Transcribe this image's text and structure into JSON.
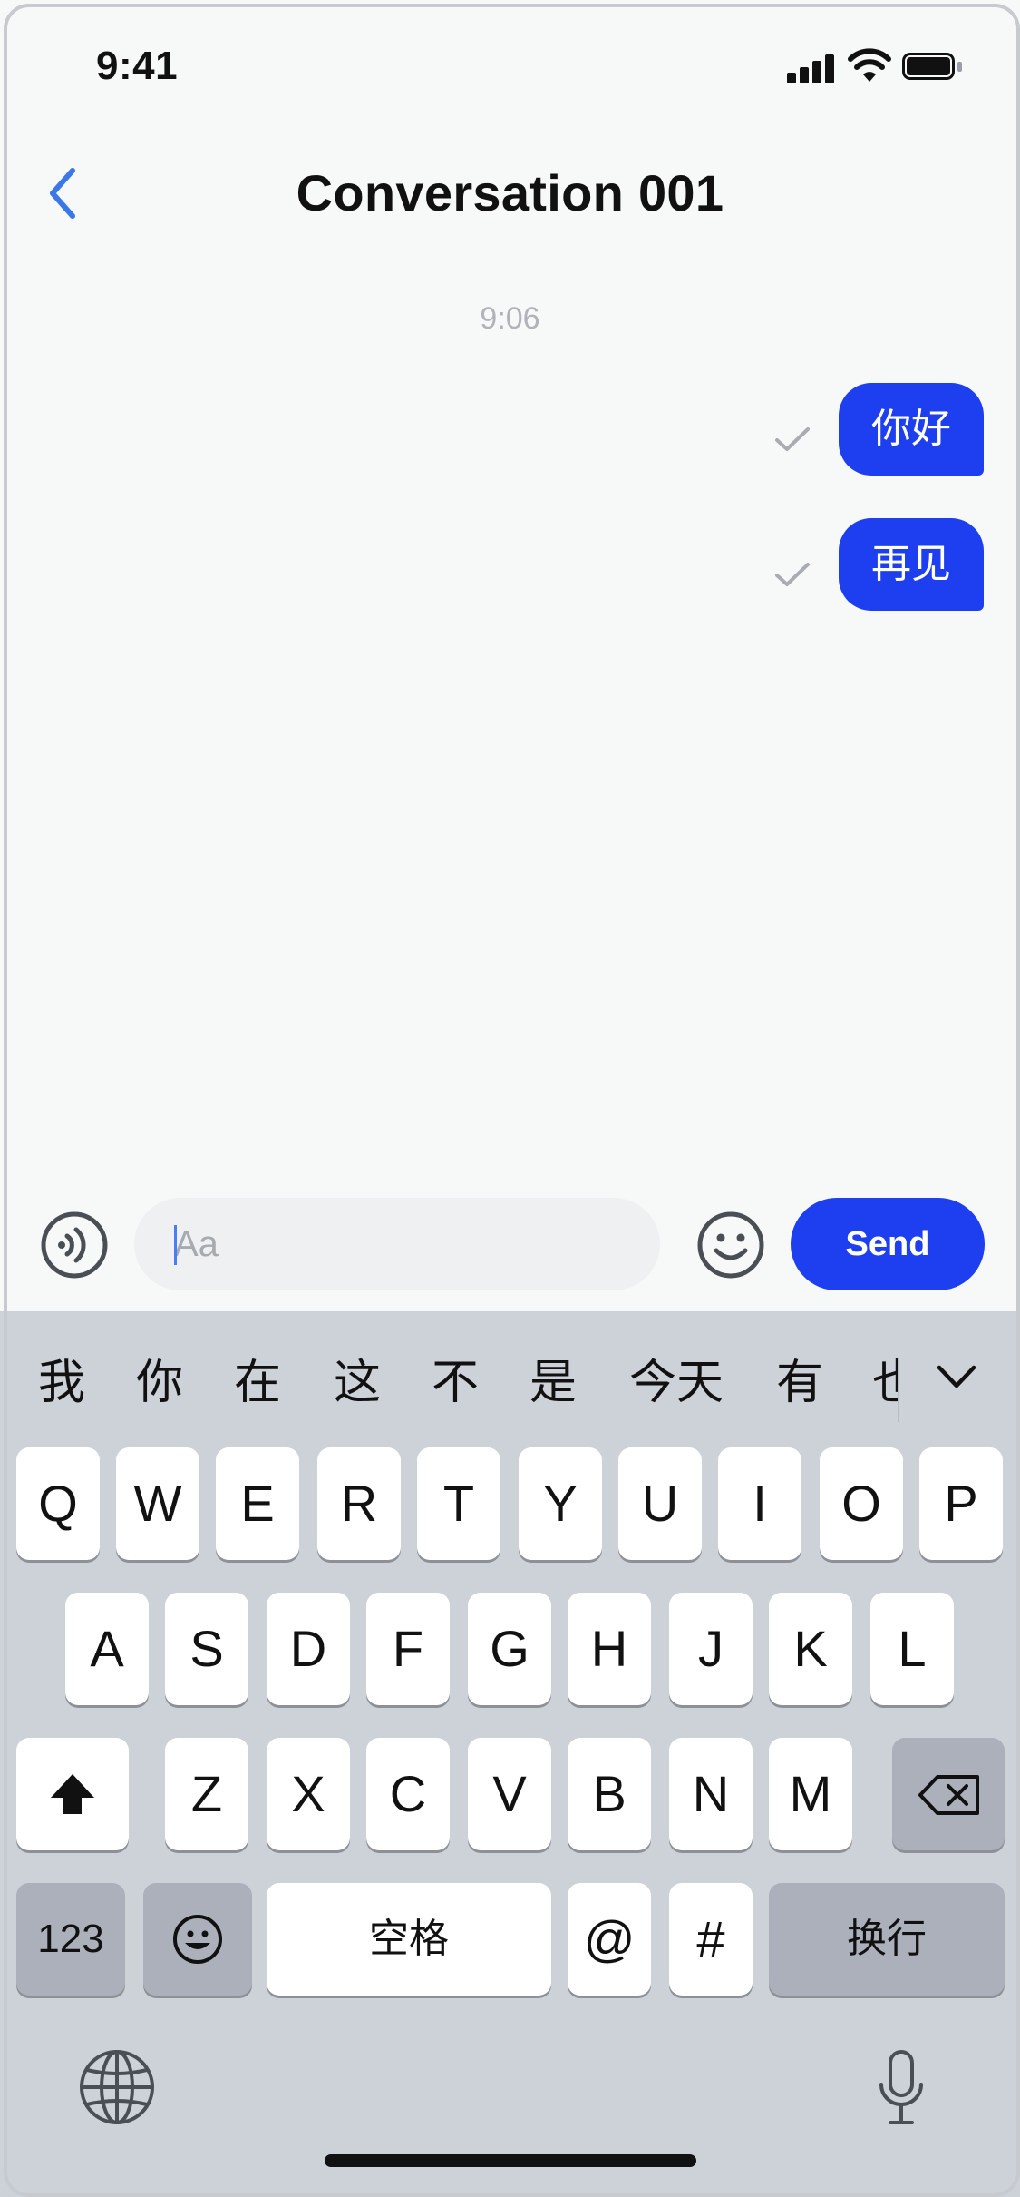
{
  "status": {
    "time": "9:41"
  },
  "header": {
    "title": "Conversation 001"
  },
  "conversation": {
    "timestamp": "9:06",
    "messages": [
      {
        "text": "你好"
      },
      {
        "text": "再见"
      }
    ]
  },
  "composer": {
    "placeholder": "Aa",
    "send_label": "Send"
  },
  "keyboard": {
    "candidates": [
      "我",
      "你",
      "在",
      "这",
      "不",
      "是",
      "今天",
      "有",
      "也"
    ],
    "row1": [
      "Q",
      "W",
      "E",
      "R",
      "T",
      "Y",
      "U",
      "I",
      "O",
      "P"
    ],
    "row2": [
      "A",
      "S",
      "D",
      "F",
      "G",
      "H",
      "J",
      "K",
      "L"
    ],
    "row3": [
      "Z",
      "X",
      "C",
      "V",
      "B",
      "N",
      "M"
    ],
    "numbers_label": "123",
    "space_label": "空格",
    "at_label": "@",
    "hash_label": "#",
    "return_label": "换行"
  },
  "icons": {
    "back": "chevron-left-icon",
    "voice": "voice-icon",
    "emoji": "emoji-icon",
    "shift": "shift-icon",
    "delete": "backspace-icon",
    "globe": "globe-icon",
    "mic": "microphone-icon"
  },
  "colors": {
    "accent": "#1d3ff0",
    "bubble_text": "#ffffff",
    "keyboard_bg": "#cdd1d8"
  }
}
